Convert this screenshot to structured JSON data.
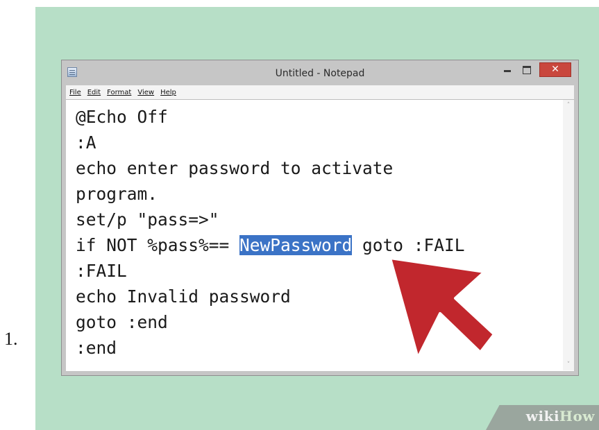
{
  "list_marker": "1.",
  "window": {
    "title": "Untitled - Notepad",
    "close_glyph": "✕"
  },
  "menu": [
    "File",
    "Edit",
    "Format",
    "View",
    "Help"
  ],
  "code": {
    "lines": [
      "@Echo Off",
      ":A",
      "echo enter password to activate",
      "program.",
      "set/p \"pass=>\"",
      ":FAIL",
      "echo Invalid password",
      "goto :end",
      ":end"
    ],
    "if_line": {
      "before": "if NOT %pass%== ",
      "selected": "NewPassword",
      "after": " goto :FAIL"
    }
  },
  "scrollbar": {
    "up_glyph": "˄",
    "down_glyph": "˅"
  },
  "watermark": {
    "part1": "wiki",
    "part2": "How"
  },
  "colors": {
    "background": "#b7dfc7",
    "selection": "#3b73c6",
    "arrow": "#c1272d",
    "close_button": "#c9473d"
  }
}
